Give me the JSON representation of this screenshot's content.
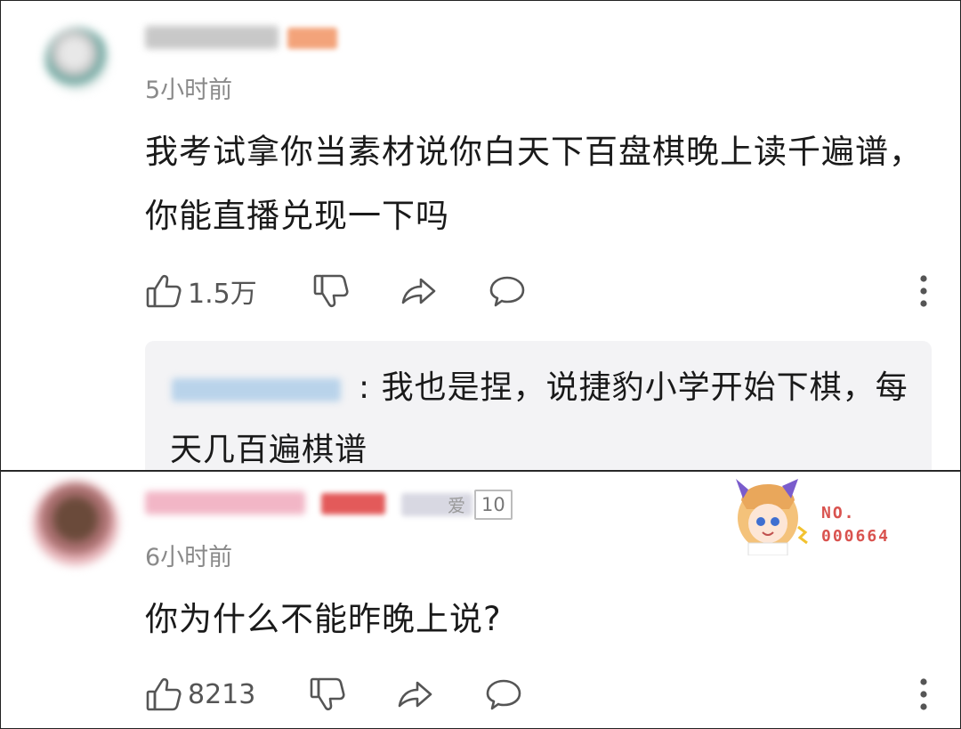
{
  "comments": [
    {
      "time": "5小时前",
      "content": "我考试拿你当素材说你白天下百盘棋晚上读千遍谱，你能直播兑现一下吗",
      "likes": "1.5万",
      "reply": {
        "text": ": 我也是捏，说捷豹小学开始下棋，每天几百遍棋谱"
      }
    },
    {
      "time": "6小时前",
      "content": "你为什么不能昨晚上说?",
      "likes": "8213",
      "fan_badge": {
        "heart": "爱",
        "level": "10"
      },
      "nft": {
        "label": "NO.",
        "number": "000664"
      }
    }
  ],
  "icons": {
    "like": "thumbs-up-icon",
    "dislike": "thumbs-down-icon",
    "share": "share-arrow-icon",
    "comment": "comment-bubble-icon",
    "more": "more-vertical-icon"
  },
  "colors": {
    "text": "#1a1a1a",
    "meta": "#8a8a8a",
    "icon": "#555555",
    "reply_bg": "#f3f3f5",
    "nft_red": "#d9534f"
  }
}
